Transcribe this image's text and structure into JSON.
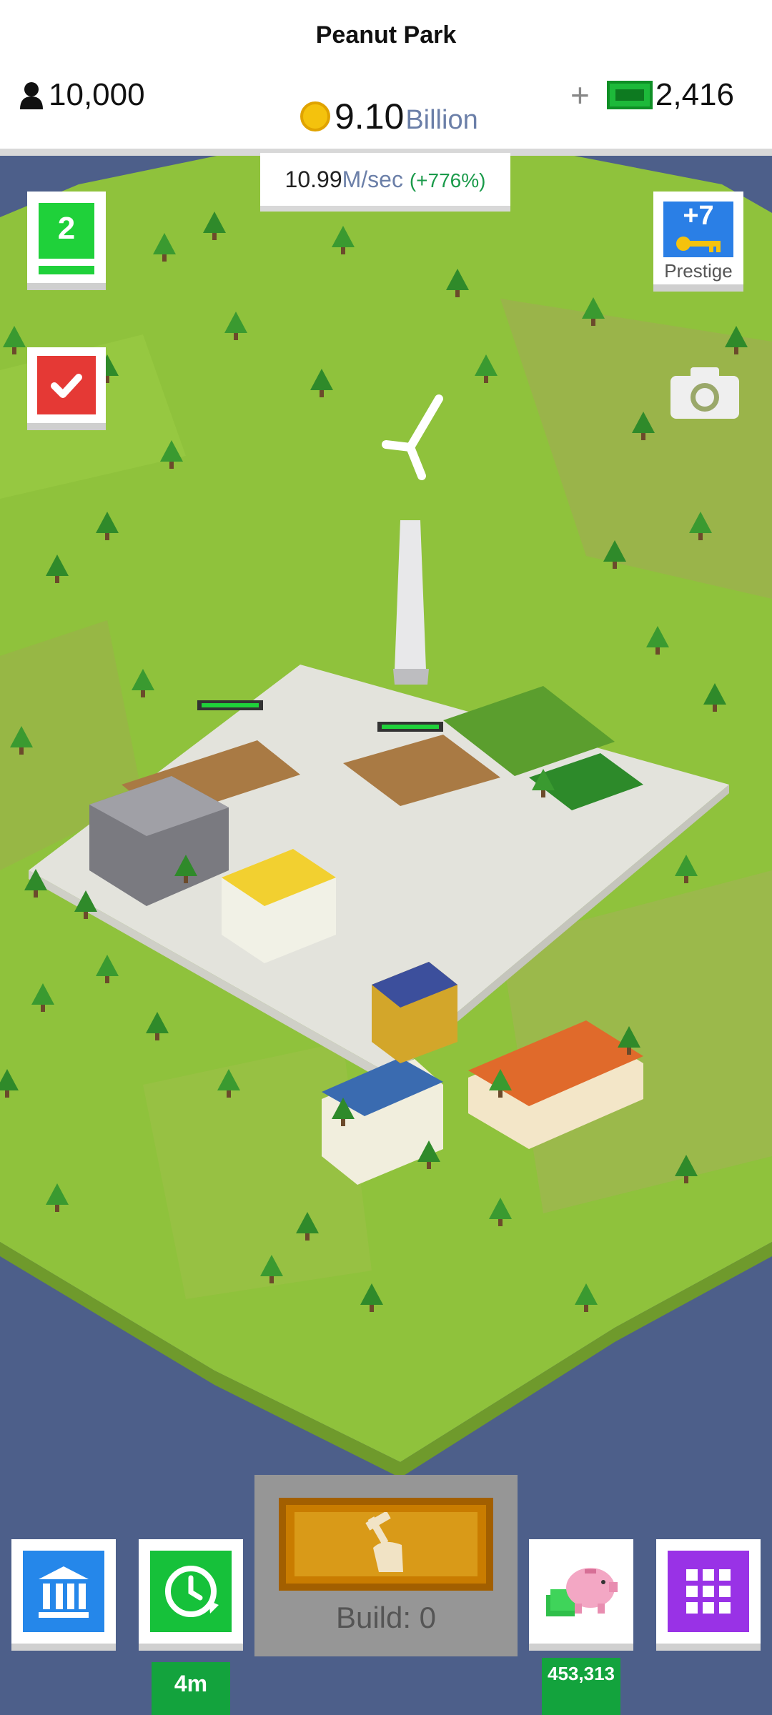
{
  "header": {
    "title": "Peanut Park",
    "population": "10,000",
    "gold_amount": "9.10",
    "gold_unit": "Billion",
    "cash_plus": "+",
    "cash": "2,416"
  },
  "income": {
    "value": "10.99",
    "unit": "M",
    "per": "/sec",
    "boost": "(+776%)"
  },
  "left_buttons": {
    "level": "2",
    "level_progress": 1.0
  },
  "right_buttons": {
    "prestige_count": "+7",
    "prestige_label": "Prestige"
  },
  "bottom_bar": {
    "build_label": "Build: 0",
    "timewarp_label": "4m",
    "bank_label": "453,313"
  },
  "colors": {
    "grass": "#8fc23c",
    "water": "#4d5f8a",
    "road": "#e3e3dc",
    "accent_green": "#16c13a",
    "gov_blue": "#2587ea",
    "pink": "#e0508a",
    "purple": "#9932e6",
    "build_orange": "#c97c00"
  },
  "icons": {
    "population": "person-icon",
    "gold": "coin-icon",
    "cash": "banknote-icon",
    "tasks": "checkmark-icon",
    "prestige": "key-icon",
    "camera": "camera-icon",
    "government": "bank-building-icon",
    "timewarp": "clock-refresh-icon",
    "build": "hammer-hand-icon",
    "piggy": "piggy-bank-icon",
    "grid": "grid-icon"
  }
}
